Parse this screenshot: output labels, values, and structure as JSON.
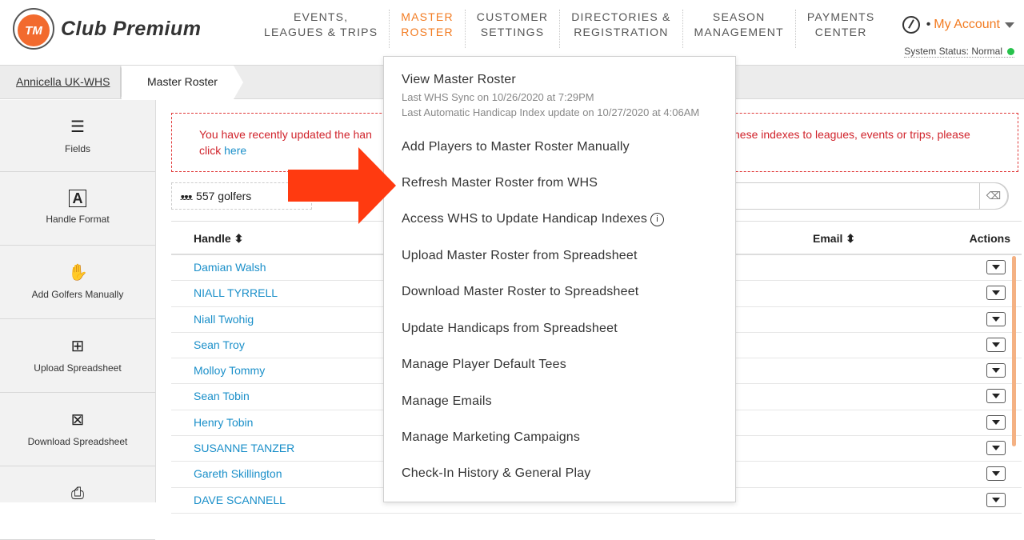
{
  "brand": {
    "badge": "TM",
    "name": "Club Premium"
  },
  "nav": [
    {
      "line1": "EVENTS,",
      "line2": "LEAGUES & TRIPS"
    },
    {
      "line1": "MASTER",
      "line2": "ROSTER"
    },
    {
      "line1": "CUSTOMER",
      "line2": "SETTINGS"
    },
    {
      "line1": "DIRECTORIES &",
      "line2": "REGISTRATION"
    },
    {
      "line1": "SEASON",
      "line2": "MANAGEMENT"
    },
    {
      "line1": "PAYMENTS",
      "line2": "CENTER"
    }
  ],
  "account": {
    "label": "My Account",
    "status": "System Status: Normal",
    "accent": "#f27b21"
  },
  "breadcrumb": {
    "club": "Annicella UK-WHS",
    "current": "Master Roster"
  },
  "sidebar": [
    {
      "label": "Fields",
      "icon": "menu-icon"
    },
    {
      "label": "Handle Format",
      "icon": "format-icon"
    },
    {
      "label": "Add Golfers Manually",
      "icon": "hand-icon"
    },
    {
      "label": "Upload Spreadsheet",
      "icon": "upload-icon"
    },
    {
      "label": "Download Spreadsheet",
      "icon": "download-icon"
    },
    {
      "label": "",
      "icon": "print-icon"
    }
  ],
  "alert": {
    "text_left": "You have recently updated the han",
    "text_right": "hese indexes to leagues, events or trips, please",
    "line2": "click ",
    "link": "here",
    "color": "#d0232b"
  },
  "roster": {
    "count": "557 golfers",
    "columns": {
      "handle": "Handle ⬍",
      "email": "Email ⬍",
      "actions": "Actions"
    },
    "rows": [
      "Damian Walsh",
      "NIALL TYRRELL",
      "Niall Twohig",
      "Sean Troy",
      "Molloy Tommy",
      "Sean Tobin",
      "Henry Tobin",
      "SUSANNE TANZER",
      "Gareth Skillington",
      "DAVE SCANNELL"
    ]
  },
  "dropdown": {
    "view": "View Master Roster",
    "sync": "Last WHS Sync on 10/26/2020 at 7:29PM",
    "auto": "Last Automatic Handicap Index update on 10/27/2020 at 4:06AM",
    "items": [
      "Add Players to Master Roster Manually",
      "Refresh Master Roster from WHS",
      "Access WHS to Update Handicap Indexes",
      "Upload Master Roster from Spreadsheet",
      "Download Master Roster to Spreadsheet",
      "Update Handicaps from Spreadsheet",
      "Manage Player Default Tees",
      "Manage Emails",
      "Manage Marketing Campaigns",
      "Check-In History & General Play"
    ]
  },
  "annotation": {
    "arrow_color": "#ff3a10"
  }
}
